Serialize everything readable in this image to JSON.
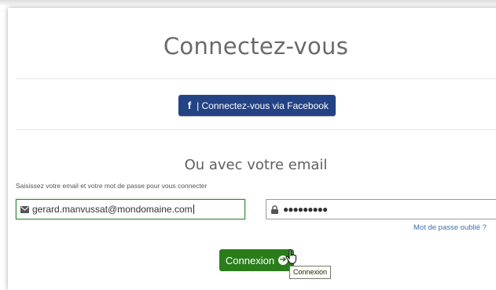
{
  "page": {
    "title": "Connectez-vous",
    "facebook_button": "| Connectez-vous via Facebook",
    "facebook_icon": "facebook-icon",
    "subtitle": "Ou avec votre email",
    "help_text": "Saisissez votre email et votre mot de passe pour vous connecter",
    "email_value": "gerard.manvussat@mondomaine.com",
    "email_icon": "envelope-icon",
    "password_value": "●●●●●●●●●",
    "password_icon": "lock-icon",
    "forgot_link": "Mot de passe oublié ?",
    "login_button": "Connexion",
    "login_icon": "arrow-circle-right-icon",
    "tooltip": "Connexion"
  },
  "colors": {
    "facebook_blue": "#234385",
    "login_green": "#2b7d1c",
    "link_blue": "#3a6fb6"
  }
}
